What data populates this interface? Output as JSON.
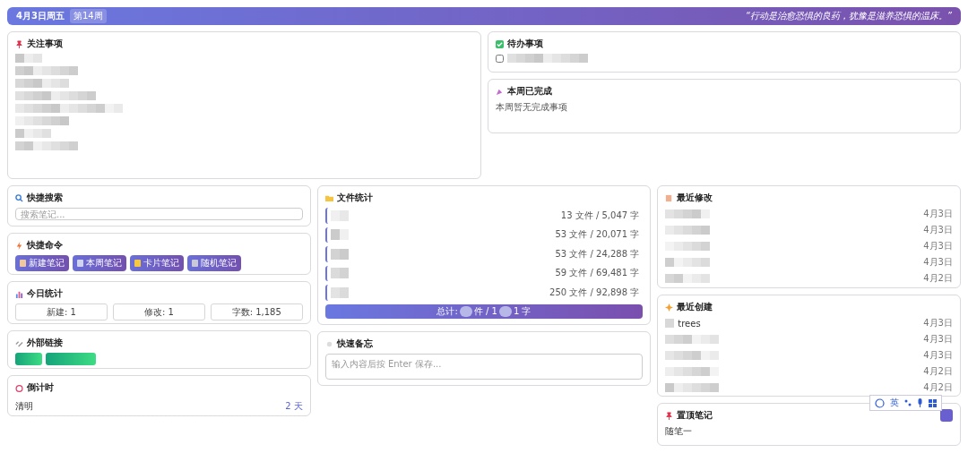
{
  "header": {
    "date": "4月3日周五",
    "week_badge": "第14周",
    "quote": "“行动是治愈恐惧的良药，犹豫是滋养恐惧的温床。”"
  },
  "focus": {
    "title": "关注事项",
    "items": [
      {
        "kind": "redacted"
      },
      {
        "kind": "redacted"
      },
      {
        "kind": "redacted"
      },
      {
        "kind": "redacted"
      },
      {
        "kind": "redacted"
      },
      {
        "kind": "redacted"
      },
      {
        "kind": "redacted"
      },
      {
        "kind": "redacted"
      }
    ]
  },
  "todo": {
    "title": "待办事项",
    "items": [
      {
        "kind": "redacted",
        "checked": false
      }
    ]
  },
  "weekly_done": {
    "title": "本周已完成",
    "empty_text": "本周暂无完成事项"
  },
  "quick_search": {
    "title": "快捷搜索",
    "placeholder": "搜索笔记..."
  },
  "quick_commands": {
    "title": "快捷命令",
    "buttons": [
      {
        "label": "新建笔记"
      },
      {
        "label": "本周笔记"
      },
      {
        "label": "卡片笔记"
      },
      {
        "label": "随机笔记"
      }
    ]
  },
  "today_stats": {
    "title": "今日统计",
    "items": [
      "新建: 1",
      "修改: 1",
      "字数: 1,185"
    ]
  },
  "external_links": {
    "title": "外部链接",
    "links": [
      {
        "kind": "redacted"
      },
      {
        "kind": "redacted"
      }
    ]
  },
  "countdown": {
    "title": "倒计时",
    "items": [
      {
        "name": "清明",
        "remaining": "2 天"
      }
    ]
  },
  "file_stats": {
    "title": "文件统计",
    "rows": [
      {
        "stat": "13 文件 / 5,047 字"
      },
      {
        "stat": "53 文件 / 20,071 字"
      },
      {
        "stat": "53 文件 / 24,288 字"
      },
      {
        "stat": "59 文件 / 69,481 字"
      },
      {
        "stat": "250 文件 / 92,898 字"
      }
    ],
    "total_parts": [
      "总计:",
      "件 / 1",
      "1 字"
    ]
  },
  "quick_memo": {
    "title": "快速备忘",
    "placeholder": "输入内容后按 Enter 保存..."
  },
  "recent_modified": {
    "title": "最近修改",
    "rows": [
      {
        "date": "4月3日"
      },
      {
        "date": "4月3日"
      },
      {
        "date": "4月3日"
      },
      {
        "date": "4月3日"
      },
      {
        "date": "4月2日"
      }
    ]
  },
  "recent_created": {
    "title": "最近创建",
    "rows": [
      {
        "name": "trees",
        "date": "4月3日"
      },
      {
        "date": "4月3日"
      },
      {
        "date": "4月3日"
      },
      {
        "date": "4月2日"
      },
      {
        "date": "4月2日"
      }
    ]
  },
  "pinned_notes": {
    "title": "置顶笔记",
    "items": [
      {
        "name": "随笔一"
      }
    ]
  },
  "ime_toolbar": {
    "mode": "英"
  }
}
